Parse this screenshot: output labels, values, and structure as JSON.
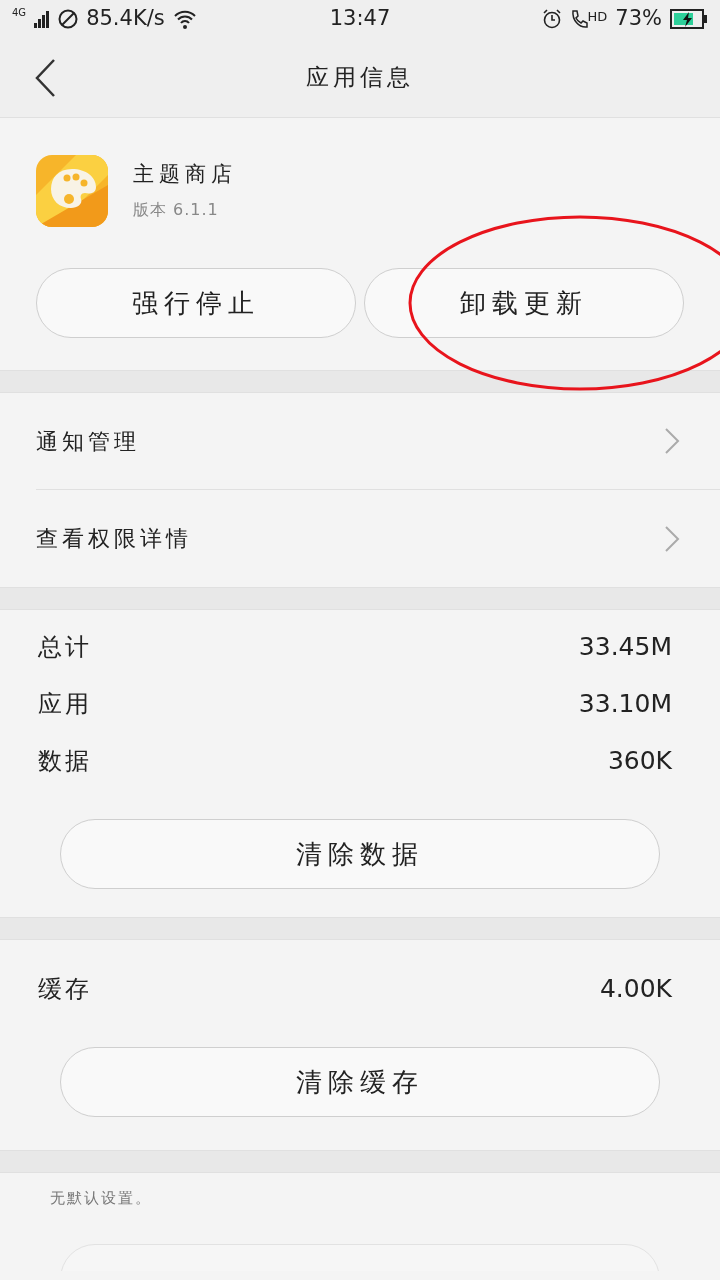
{
  "status_bar": {
    "network": "4G",
    "speed": "85.4K/s",
    "time": "13:47",
    "hd": "HD",
    "battery": "73%",
    "charging": true
  },
  "header": {
    "title": "应用信息"
  },
  "app": {
    "name": "主题商店",
    "version": "版本 6.1.1"
  },
  "app_buttons": [
    {
      "label": "强行停止"
    },
    {
      "label": "卸载更新"
    }
  ],
  "annotation": {
    "kind": "ellipse",
    "color": "#e8141c"
  },
  "menu": [
    {
      "label": "通知管理"
    },
    {
      "label": "查看权限详情"
    }
  ],
  "storage": {
    "rows": [
      {
        "label": "总计",
        "value": "33.45M"
      },
      {
        "label": "应用",
        "value": "33.10M"
      },
      {
        "label": "数据",
        "value": "360K"
      }
    ],
    "button": "清除数据"
  },
  "cache": {
    "rows": [
      {
        "label": "缓存",
        "value": "4.00K"
      }
    ],
    "button": "清除缓存"
  },
  "defaults": {
    "text": "无默认设置。",
    "button": {
      "disabled": true
    }
  }
}
